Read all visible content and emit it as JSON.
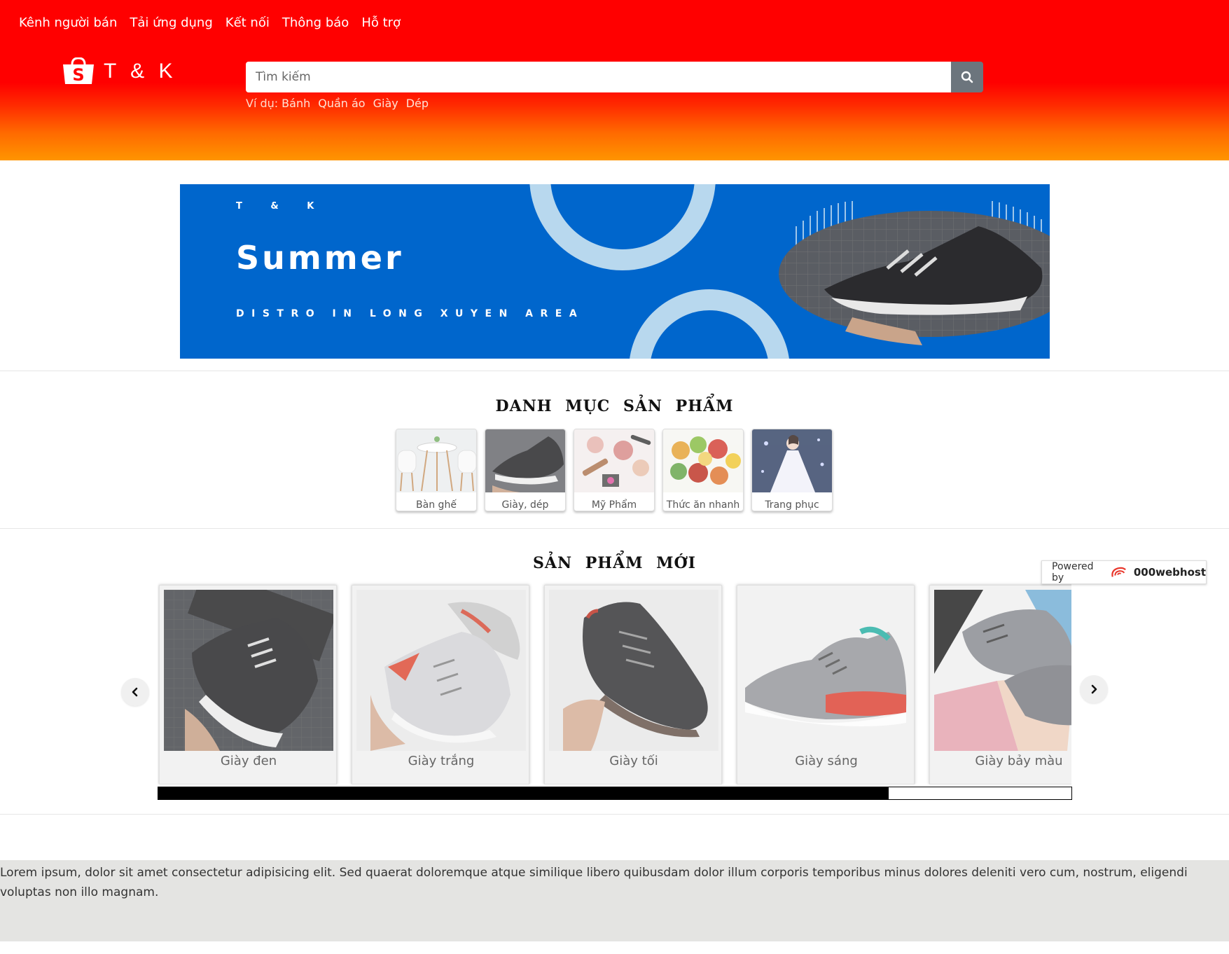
{
  "topnav": {
    "items": [
      "Kênh người bán",
      "Tải ứng dụng",
      "Kết nối",
      "Thông báo",
      "Hỗ trợ"
    ]
  },
  "logo": {
    "text": "T & K",
    "icon": "shopping-bag-icon"
  },
  "search": {
    "placeholder": "Tìm kiếm",
    "icon": "search-icon",
    "suggest_label": "Ví dụ:",
    "suggestions": [
      "Bánh",
      "Quần áo",
      "Giày",
      "Dép"
    ]
  },
  "banner": {
    "brand": "T & K",
    "headline": "Summer",
    "subline": "DISTRO IN LONG XUYEN AREA"
  },
  "categories": {
    "title": "DANH MỤC SẢN PHẨM",
    "items": [
      {
        "label": "Bàn ghế"
      },
      {
        "label": "Giày, dép"
      },
      {
        "label": "Mỹ Phẩm"
      },
      {
        "label": "Thức ăn nhanh"
      },
      {
        "label": "Trang phục"
      }
    ]
  },
  "products": {
    "title": "SẢN PHẨM MỚI",
    "items": [
      {
        "label": "Giày đen"
      },
      {
        "label": "Giày trắng"
      },
      {
        "label": "Giày tối"
      },
      {
        "label": "Giày sáng"
      },
      {
        "label": "Giày bảy màu"
      }
    ],
    "scroll_progress": 0.8
  },
  "powered": {
    "label": "Powered by",
    "brand": "000webhost"
  },
  "footer": {
    "text": "Lorem ipsum, dolor sit amet consectetur adipisicing elit. Sed quaerat doloremque atque similique libero quibusdam dolor illum corporis temporibus minus dolores deleniti vero cum, nostrum, eligendi voluptas non illo magnam."
  },
  "colors": {
    "header_top": "#ff0000",
    "header_bottom": "#ff9500",
    "banner_bg": "#0066cc",
    "footer_bg": "#e4e4e2"
  }
}
